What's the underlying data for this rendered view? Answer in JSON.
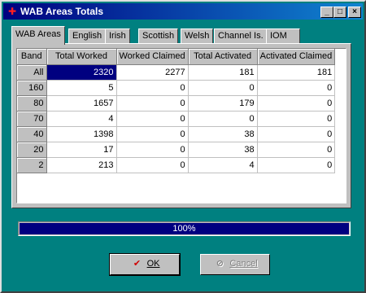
{
  "window": {
    "title": "WAB Areas Totals"
  },
  "title_buttons": {
    "minimize": "_",
    "maximize": "□",
    "close": "×"
  },
  "tabs": [
    {
      "label": "WAB Areas",
      "active": true
    },
    {
      "label": "English"
    },
    {
      "label": "Irish"
    },
    {
      "label": "Scottish"
    },
    {
      "label": "Welsh"
    },
    {
      "label": "Channel Is."
    },
    {
      "label": "IOM"
    }
  ],
  "table": {
    "columns": [
      "Band",
      "Total Worked",
      "Worked Claimed",
      "Total Activated",
      "Activated Claimed"
    ],
    "rows": [
      {
        "band": "All",
        "total_worked": "2320",
        "worked_claimed": "2277",
        "total_activated": "181",
        "activated_claimed": "181"
      },
      {
        "band": "160",
        "total_worked": "5",
        "worked_claimed": "0",
        "total_activated": "0",
        "activated_claimed": "0"
      },
      {
        "band": "80",
        "total_worked": "1657",
        "worked_claimed": "0",
        "total_activated": "179",
        "activated_claimed": "0"
      },
      {
        "band": "70",
        "total_worked": "4",
        "worked_claimed": "0",
        "total_activated": "0",
        "activated_claimed": "0"
      },
      {
        "band": "40",
        "total_worked": "1398",
        "worked_claimed": "0",
        "total_activated": "38",
        "activated_claimed": "0"
      },
      {
        "band": "20",
        "total_worked": "17",
        "worked_claimed": "0",
        "total_activated": "38",
        "activated_claimed": "0"
      },
      {
        "band": "2",
        "total_worked": "213",
        "worked_claimed": "0",
        "total_activated": "4",
        "activated_claimed": "0"
      }
    ]
  },
  "progress": {
    "value": 1.0,
    "label": "100%"
  },
  "buttons": {
    "ok": {
      "label": "OK",
      "icon": "checkmark-icon"
    },
    "cancel": {
      "label": "Cancel",
      "icon": "no-entry-icon",
      "disabled": true
    }
  },
  "colors": {
    "background": "#008080",
    "selection": "#000080",
    "face": "#c0c0c0"
  }
}
